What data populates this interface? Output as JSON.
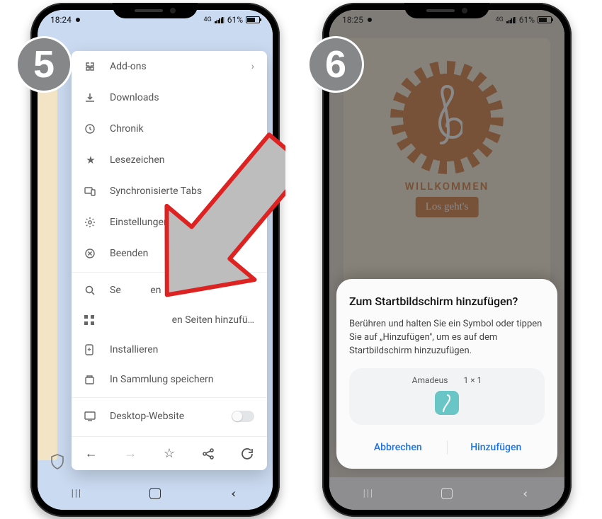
{
  "badges": {
    "step5": "5",
    "step6": "6"
  },
  "statusbar": {
    "time5": "18:24",
    "time6": "18:25",
    "net": "4G",
    "battery": "61%"
  },
  "phone5": {
    "menu": {
      "addons": "Add-ons",
      "downloads": "Downloads",
      "history": "Chronik",
      "bookmarks": "Lesezeichen",
      "synced_tabs": "Synchronisierte Tabs",
      "settings": "Einstellungen",
      "quit": "Beenden",
      "search_partial_pre": "Se",
      "search_partial_post": "en",
      "top_sites_partial": "en Seiten hinzufü…",
      "install": "Installieren",
      "save_collection": "In Sammlung speichern",
      "desktop_site": "Desktop-Website"
    }
  },
  "phone6": {
    "page": {
      "welcome": "WILLKOMMEN",
      "cta": "Los geht's"
    },
    "dialog": {
      "title": "Zum Startbildschirm hinzufügen?",
      "body": "Berühren und halten Sie ein Symbol oder tippen Sie auf „Hinzufügen\", um es auf dem Startbildschirm hinzuzufügen.",
      "app_name": "Amadeus",
      "app_size": "1 × 1",
      "cancel": "Abbrechen",
      "add": "Hinzufügen"
    }
  }
}
